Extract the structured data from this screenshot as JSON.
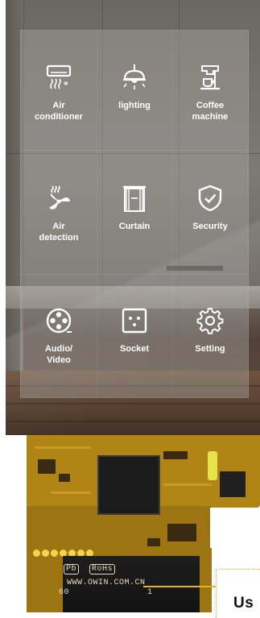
{
  "tiles": [
    {
      "label": "Air\nconditioner",
      "icon": "air-conditioner-icon"
    },
    {
      "label": "lighting",
      "icon": "lighting-icon"
    },
    {
      "label": "Coffee\nmachine",
      "icon": "coffee-machine-icon"
    },
    {
      "label": "Air\ndetection",
      "icon": "air-detection-icon"
    },
    {
      "label": "Curtain",
      "icon": "curtain-icon"
    },
    {
      "label": "Security",
      "icon": "security-shield-icon"
    },
    {
      "label": "Audio/\nVideo",
      "icon": "audio-video-icon"
    },
    {
      "label": "Socket",
      "icon": "socket-icon"
    },
    {
      "label": "Setting",
      "icon": "gear-icon"
    }
  ],
  "board": {
    "pb_mark": "Pb",
    "rohs_mark": "RoHs",
    "silk_url": "WWW.OWIN.COM.CN",
    "silk_num_left": "60",
    "silk_num_right": "1"
  },
  "callout": {
    "text": "Us"
  },
  "colors": {
    "accent_callout": "#e7b21a",
    "board_gold": "#b08515",
    "panel_text": "#ffffff"
  }
}
